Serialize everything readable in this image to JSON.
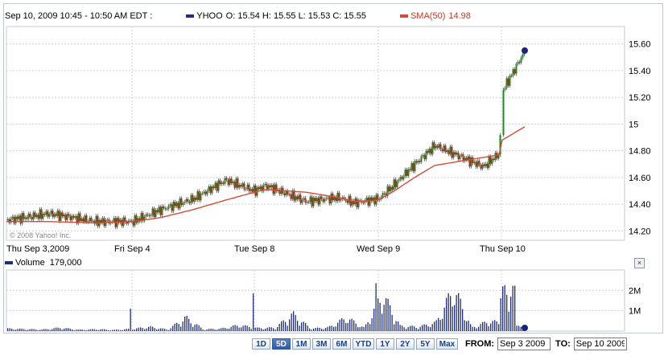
{
  "header": {
    "timestamp": "Sep 10, 2009 10:45 - 10:50 AM EDT :",
    "ticker": "YHOO",
    "ohlc": "O: 15.54 H: 15.55 L: 15.53 C: 15.55",
    "sma_label": "SMA(50)",
    "sma_value": "14.98"
  },
  "colors": {
    "up": "#1a8c1a",
    "down": "#c0202a",
    "sma": "#d84a38",
    "volume": "#1f2d7a",
    "grid": "#d0d0d0"
  },
  "copyright": "© 2008 Yahoo! Inc.",
  "volume_header": {
    "label": "Volume",
    "value": "179,000"
  },
  "close_glyph": "×",
  "ranges": [
    {
      "label": "1D",
      "active": false
    },
    {
      "label": "5D",
      "active": true
    },
    {
      "label": "1M",
      "active": false
    },
    {
      "label": "3M",
      "active": false
    },
    {
      "label": "6M",
      "active": false
    },
    {
      "label": "YTD",
      "active": false
    },
    {
      "label": "1Y",
      "active": false
    },
    {
      "label": "2Y",
      "active": false
    },
    {
      "label": "5Y",
      "active": false
    },
    {
      "label": "Max",
      "active": false
    }
  ],
  "from_label": "FROM:",
  "from_value": "Sep 3 2009",
  "to_label": "TO:",
  "to_value": "Sep 10 2009",
  "chart_data": [
    {
      "type": "line",
      "series": [
        {
          "name": "YHOO",
          "style": "candlestick",
          "x": [
            "Thu Sep 3,2009",
            "Thu Sep 3,2009",
            "Thu Sep 3,2009",
            "Fri Sep 4",
            "Fri Sep 4",
            "Fri Sep 4",
            "Fri Sep 4",
            "Tue Sep 8",
            "Tue Sep 8",
            "Tue Sep 8",
            "Tue Sep 8",
            "Wed Sep 9",
            "Wed Sep 9",
            "Wed Sep 9",
            "Wed Sep 9",
            "Wed Sep 9",
            "Wed Sep 9",
            "Thu Sep 10",
            "Thu Sep 10",
            "Thu Sep 10"
          ],
          "points": [
            14.28,
            14.33,
            14.27,
            14.27,
            14.36,
            14.44,
            14.58,
            14.5,
            14.54,
            14.42,
            14.45,
            14.41,
            14.44,
            14.55,
            14.7,
            14.84,
            14.68,
            14.78,
            15.25,
            15.55
          ]
        },
        {
          "name": "SMA(50)",
          "points": [
            14.27,
            14.27,
            14.26,
            14.27,
            14.3,
            14.36,
            14.43,
            14.49,
            14.51,
            14.49,
            14.45,
            14.42,
            14.43,
            14.5,
            14.6,
            14.69,
            14.75,
            14.77,
            14.88,
            14.98
          ]
        }
      ],
      "x_ticks": [
        "Thu Sep 3,2009",
        "Fri Sep 4",
        "Tue Sep 8",
        "Wed Sep 9",
        "Thu Sep 10"
      ],
      "y_ticks": [
        "14.20",
        "14.40",
        "14.60",
        "14.80",
        "15",
        "15.20",
        "15.40",
        "15.60"
      ],
      "ylim": [
        14.13,
        15.73
      ],
      "grid": true
    },
    {
      "type": "bar",
      "series": [
        {
          "name": "Volume",
          "values": [
            150000,
            120000,
            90000,
            200000,
            80000,
            110000,
            70000,
            130000,
            250000,
            90000,
            800000,
            100000,
            150000,
            350000,
            180000,
            200000,
            1000000,
            150000,
            220000,
            800000,
            180000,
            2200000,
            300000,
            250000,
            500000,
            2500000,
            200000,
            600000,
            400000,
            179000
          ]
        }
      ],
      "y_ticks": [
        "1M",
        "2M"
      ],
      "ylim": [
        0,
        3000000
      ],
      "grid": true
    }
  ]
}
